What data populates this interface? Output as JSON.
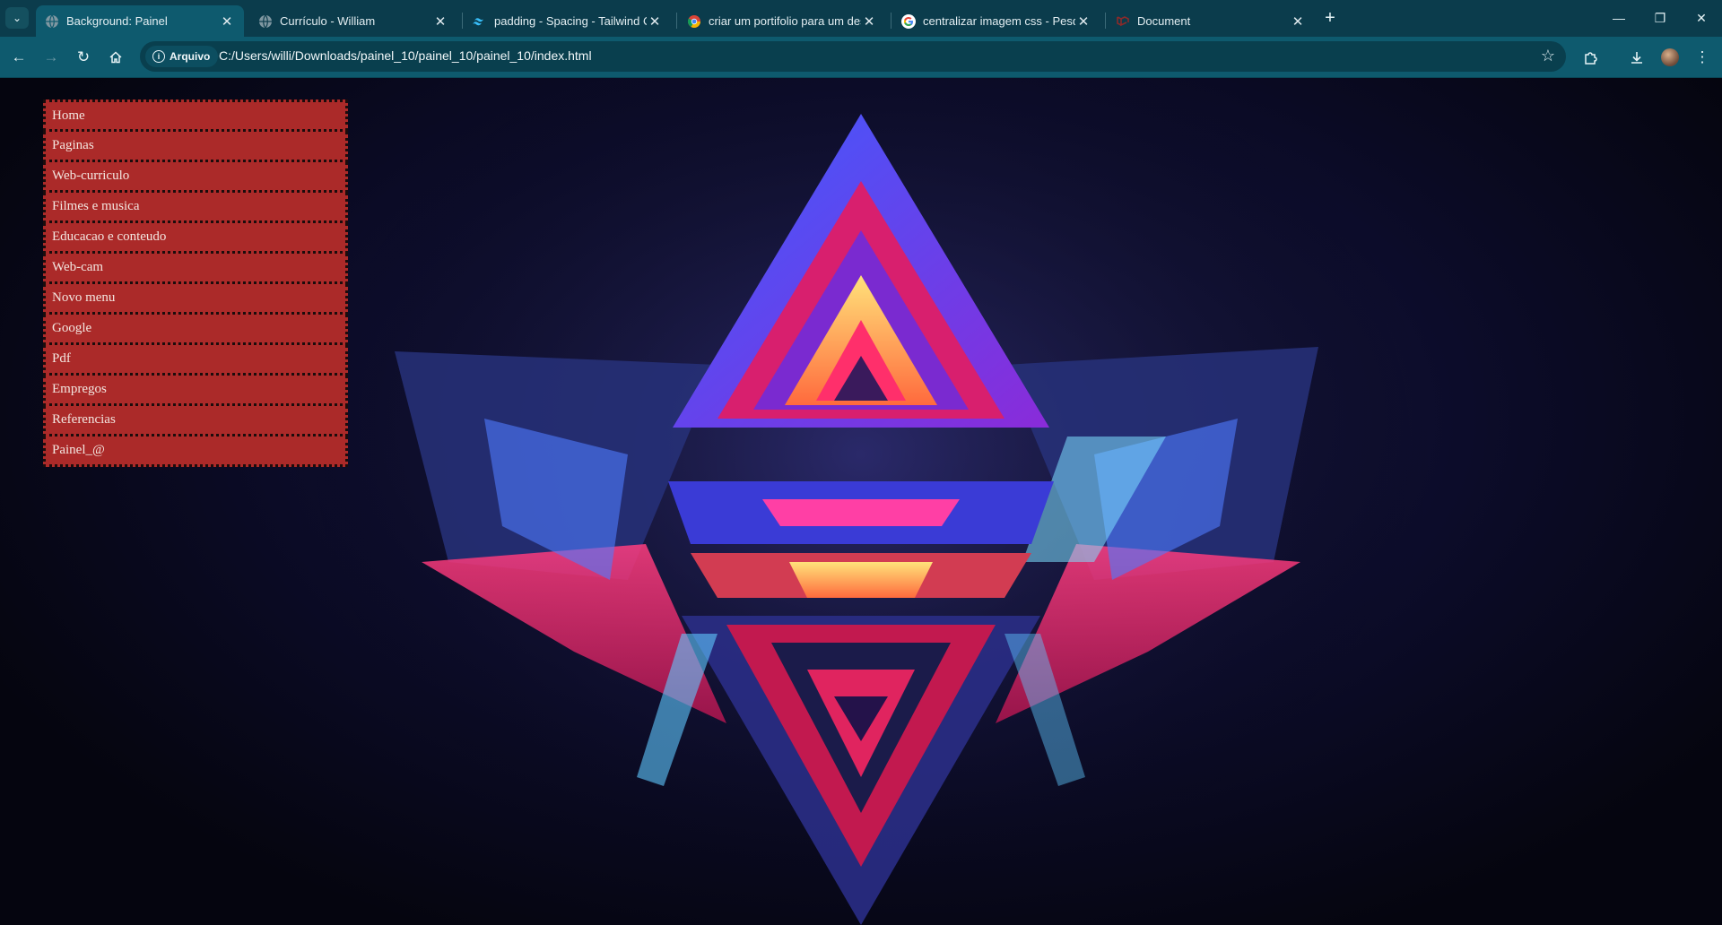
{
  "browser": {
    "tabs": [
      {
        "title": "Background: Painel",
        "active": true,
        "icon": "globe-icon"
      },
      {
        "title": "Currículo - William",
        "active": false,
        "icon": "globe-icon"
      },
      {
        "title": "padding - Spacing - Tailwind CSS",
        "active": false,
        "icon": "tailwind-icon"
      },
      {
        "title": "criar um portifolio para um des",
        "active": false,
        "icon": "chrome-icon"
      },
      {
        "title": "centralizar imagem css - Pesqu",
        "active": false,
        "icon": "google-icon"
      },
      {
        "title": "Document",
        "active": false,
        "icon": "laravel-icon"
      }
    ],
    "address": {
      "chip_label": "Arquivo",
      "url": "C:/Users/willi/Downloads/painel_10/painel_10/painel_10/index.html"
    }
  },
  "page": {
    "menu": [
      "Home",
      "Paginas",
      "Web-curriculo",
      "Filmes e musica",
      "Educacao e conteudo",
      "Web-cam",
      "Novo menu",
      "Google",
      "Pdf",
      "Empregos",
      "Referencias",
      "Painel_@"
    ],
    "menu_color": "#ab2a29"
  }
}
